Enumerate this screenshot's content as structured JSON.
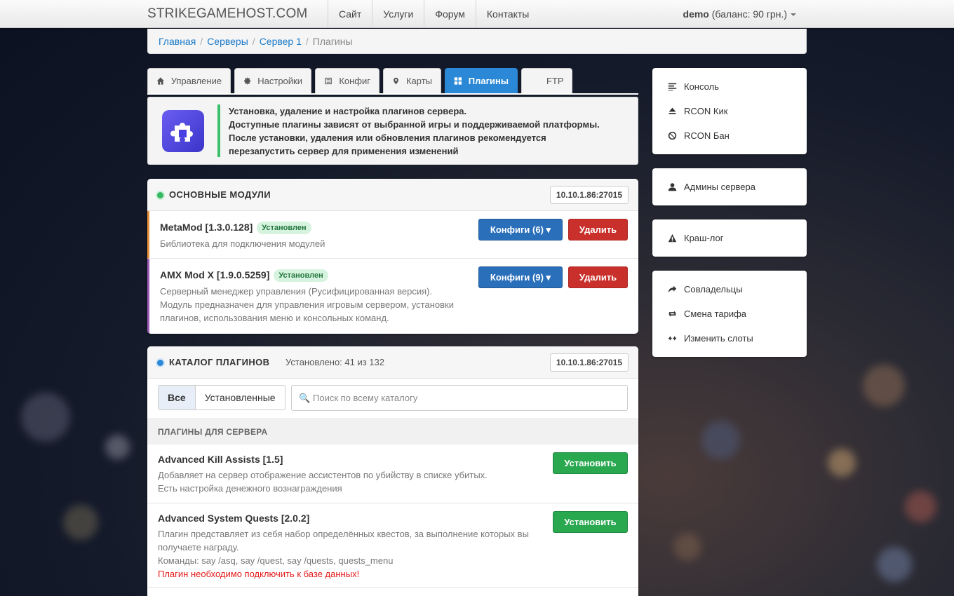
{
  "header": {
    "brand": "STRIKEGAMEHOST.COM",
    "nav": [
      "Сайт",
      "Услуги",
      "Форум",
      "Контакты"
    ],
    "user_name": "demo",
    "user_balance": "(баланс: 90 грн.)"
  },
  "breadcrumb": {
    "items": [
      "Главная",
      "Серверы",
      "Сервер 1"
    ],
    "current": "Плагины"
  },
  "tabs": [
    "Управление",
    "Настройки",
    "Конфиг",
    "Карты",
    "Плагины",
    "FTP"
  ],
  "info": {
    "lines": [
      "Установка, удаление и настройка плагинов сервера.",
      "Доступные плагины зависят от выбранной игры и поддерживаемой платформы.",
      "После установки, удаления или обновления плагинов рекомендуется",
      "перезапустить сервер для применения изменений"
    ]
  },
  "core": {
    "title": "ОСНОВНЫЕ МОДУЛИ",
    "ip": "10.10.1.86:27015",
    "modules": [
      {
        "name": "MetaMod [1.3.0.128]",
        "badge": "Установлен",
        "desc": [
          "Библиотека для подключения модулей"
        ],
        "config_label": "Конфиги (6) ▾",
        "delete_label": "Удалить"
      },
      {
        "name": "AMX Mod X [1.9.0.5259]",
        "badge": "Установлен",
        "desc": [
          "Серверный менеджер управления (Русифицированная версия).",
          "Модуль предназначен для управления игровым сервером, установки",
          "плагинов, использования меню и консольных команд."
        ],
        "config_label": "Конфиги (9) ▾",
        "delete_label": "Удалить"
      }
    ]
  },
  "catalog": {
    "title": "КАТАЛОГ ПЛАГИНОВ",
    "installed": "Установлено: 41 из 132",
    "ip": "10.10.1.86:27015",
    "filter_all": "Все",
    "filter_installed": "Установленные",
    "search_placeholder": "Поиск по всему каталогу",
    "section": "ПЛАГИНЫ ДЛЯ СЕРВЕРА",
    "install_label": "Установить",
    "plugins": [
      {
        "name": "Advanced Kill Assists [1.5]",
        "desc": [
          "Добавляет на сервер отображение ассистентов по убийству в списке убитых.",
          "Есть настройка денежного вознаграждения"
        ]
      },
      {
        "name": "Advanced System Quests [2.0.2]",
        "desc": [
          "Плагин представляет из себя набор определённых квестов, за выполнение которых вы",
          "получаете награду.",
          "Команды: say /asq, say /quest, say /quests, quests_menu"
        ],
        "warning": "Плагин необходимо подключить к базе данных!"
      }
    ]
  },
  "sidebar": {
    "group1": [
      "Консоль",
      "RCON Кик",
      "RCON Бан"
    ],
    "group2": [
      "Админы сервера"
    ],
    "group3": [
      "Краш-лог"
    ],
    "group4": [
      "Совладельцы",
      "Смена тарифа",
      "Изменить слоты"
    ]
  },
  "colors": {
    "accent": "#2a88d6",
    "success": "#29a850",
    "danger": "#c9302c",
    "installed_badge": "#d6f3df"
  }
}
